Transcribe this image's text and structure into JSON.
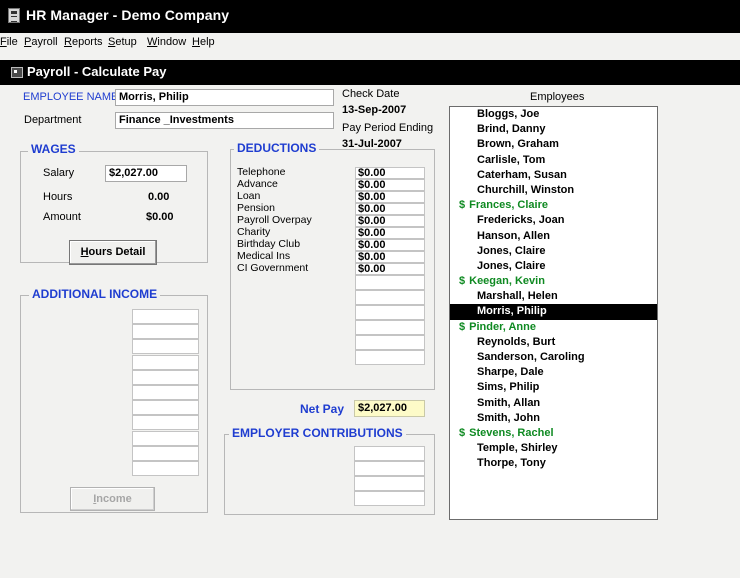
{
  "window": {
    "title": "HR Manager - Demo Company"
  },
  "menu": [
    "File",
    "Payroll",
    "Reports",
    "Setup",
    "Window",
    "Help"
  ],
  "child": {
    "title": "Payroll - Calculate Pay"
  },
  "employee": {
    "name_label": "EMPLOYEE NAME",
    "name": "Morris, Philip",
    "dept_label": "Department",
    "dept": "Finance _Investments"
  },
  "check": {
    "check_date_label": "Check Date",
    "check_date": "13-Sep-2007",
    "period_label": "Pay Period Ending",
    "period_end": "31-Jul-2007"
  },
  "wages": {
    "title": "WAGES",
    "salary_label": "Salary",
    "salary": "$2,027.00",
    "hours_label": "Hours",
    "hours": "0.00",
    "amount_label": "Amount",
    "amount": "$0.00",
    "hours_detail_button": "Hours Detail"
  },
  "additional_income": {
    "title": "ADDITIONAL INCOME",
    "income_button": "Income"
  },
  "deductions": {
    "title": "DEDUCTIONS",
    "items": [
      {
        "label": "Telephone",
        "value": "$0.00"
      },
      {
        "label": "Advance",
        "value": "$0.00"
      },
      {
        "label": "Loan",
        "value": "$0.00"
      },
      {
        "label": "Pension",
        "value": "$0.00"
      },
      {
        "label": "Payroll Overpay",
        "value": "$0.00"
      },
      {
        "label": "Charity",
        "value": "$0.00"
      },
      {
        "label": "Birthday Club",
        "value": "$0.00"
      },
      {
        "label": "Medical Ins",
        "value": "$0.00"
      },
      {
        "label": "CI Government",
        "value": "$0.00"
      }
    ]
  },
  "net_pay": {
    "label": "Net Pay",
    "value": "$2,027.00"
  },
  "employer_contributions": {
    "title": "EMPLOYER CONTRIBUTIONS"
  },
  "employees": {
    "title": "Employees",
    "selected": "Morris, Philip",
    "list": [
      {
        "name": "Bloggs, Joe",
        "flag": ""
      },
      {
        "name": "Brind, Danny",
        "flag": ""
      },
      {
        "name": "Brown, Graham",
        "flag": ""
      },
      {
        "name": "Carlisle, Tom",
        "flag": ""
      },
      {
        "name": "Caterham, Susan",
        "flag": ""
      },
      {
        "name": "Churchill, Winston",
        "flag": ""
      },
      {
        "name": "Frances, Claire",
        "flag": "$"
      },
      {
        "name": "Fredericks, Joan",
        "flag": ""
      },
      {
        "name": "Hanson, Allen",
        "flag": ""
      },
      {
        "name": "Jones, Claire",
        "flag": ""
      },
      {
        "name": "Jones, Claire",
        "flag": ""
      },
      {
        "name": "Keegan, Kevin",
        "flag": "$"
      },
      {
        "name": "Marshall, Helen",
        "flag": ""
      },
      {
        "name": "Morris, Philip",
        "flag": ""
      },
      {
        "name": "Pinder, Anne",
        "flag": "$"
      },
      {
        "name": "Reynolds, Burt",
        "flag": ""
      },
      {
        "name": "Sanderson, Caroling",
        "flag": ""
      },
      {
        "name": "Sharpe, Dale",
        "flag": ""
      },
      {
        "name": "Sims, Philip",
        "flag": ""
      },
      {
        "name": "Smith, Allan",
        "flag": ""
      },
      {
        "name": "Smith, John",
        "flag": ""
      },
      {
        "name": "Stevens, Rachel",
        "flag": "$"
      },
      {
        "name": "Temple, Shirley",
        "flag": ""
      },
      {
        "name": "Thorpe, Tony",
        "flag": ""
      }
    ]
  },
  "colors": {
    "label_blue": "#1f3dd0",
    "paid_green": "#0f8a22",
    "net_pay_bg": "#fdfbc8",
    "chrome": "#000000"
  }
}
